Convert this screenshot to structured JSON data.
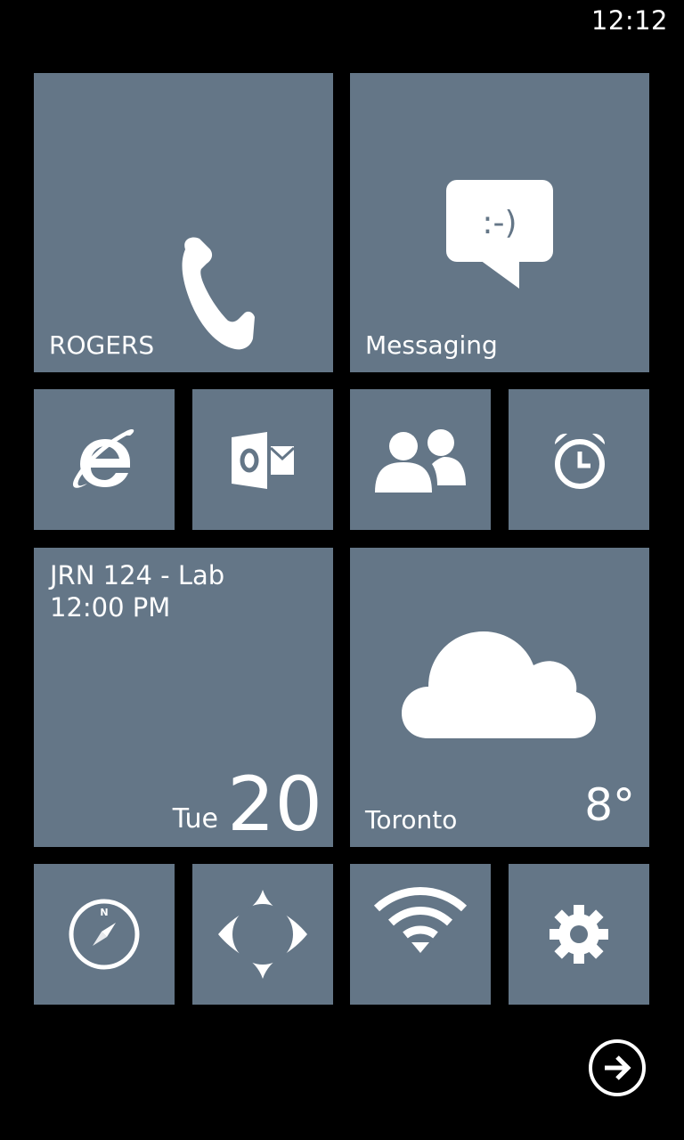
{
  "status_bar": {
    "time": "12:12"
  },
  "tiles": {
    "phone": {
      "label": "ROGERS",
      "icon": "phone-icon"
    },
    "messaging": {
      "label": "Messaging",
      "icon": "messaging-icon",
      "emoticon": ":-)"
    },
    "internet_explorer": {
      "icon": "internet-explorer-icon"
    },
    "outlook": {
      "icon": "outlook-icon"
    },
    "people": {
      "icon": "people-icon"
    },
    "alarms": {
      "icon": "alarm-clock-icon"
    },
    "calendar": {
      "event_title": "JRN 124 - Lab",
      "event_time": "12:00 PM",
      "day": "Tue",
      "date": "20"
    },
    "weather": {
      "city": "Toronto",
      "temperature": "8°",
      "icon": "cloud-icon"
    },
    "compass": {
      "icon": "compass-icon",
      "letter": "N"
    },
    "maps": {
      "icon": "maps-icon"
    },
    "wifi": {
      "icon": "wifi-icon"
    },
    "settings": {
      "icon": "gear-icon"
    }
  },
  "navigation": {
    "all_apps_icon": "arrow-right-icon"
  },
  "colors": {
    "background": "#000000",
    "tile": "#647687",
    "foreground": "#ffffff"
  }
}
